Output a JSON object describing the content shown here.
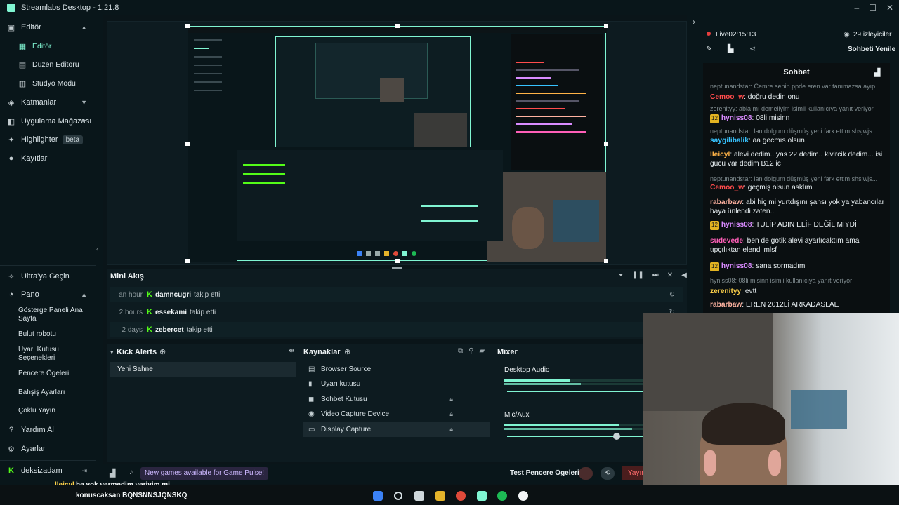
{
  "window": {
    "title": "Streamlabs Desktop - 1.21.8"
  },
  "sidebar": {
    "items": [
      {
        "label": "Editör",
        "icon": "editor-icon",
        "chevron": "⌃"
      },
      {
        "label": "Editör",
        "icon": "editor-sub-icon"
      },
      {
        "label": "Düzen Editörü",
        "icon": "layout-icon"
      },
      {
        "label": "Stüdyo Modu",
        "icon": "studio-icon"
      },
      {
        "label": "Katmanlar",
        "icon": "layers-icon",
        "chevron": "⌄"
      },
      {
        "label": "Uygulama Mağazası",
        "icon": "store-icon",
        "chevron": "⌄"
      },
      {
        "label": "Highlighter",
        "icon": "highlighter-icon",
        "badge": "beta"
      },
      {
        "label": "Kayıtlar",
        "icon": "recordings-icon"
      }
    ],
    "bottom": [
      {
        "label": "Ultra'ya Geçin",
        "icon": "ultra-icon"
      },
      {
        "label": "Pano",
        "icon": "dashboard-icon",
        "chevron": "⌃"
      },
      {
        "label": "Gösterge Paneli Ana Sayfa"
      },
      {
        "label": "Bulut robotu"
      },
      {
        "label": "Uyarı Kutusu Seçenekleri"
      },
      {
        "label": "Pencere Ögeleri"
      },
      {
        "label": "Bahşiş Ayarları"
      },
      {
        "label": "Çoklu Yayın"
      },
      {
        "label": "Yardım Al",
        "icon": "help-icon"
      },
      {
        "label": "Ayarlar",
        "icon": "settings-icon"
      },
      {
        "label": "deksizadam",
        "icon": "kick-icon"
      }
    ]
  },
  "chat_header": {
    "live": "Live02:15:13",
    "viewers": "29 izleyiciler",
    "refresh": "Sohbeti Yenile",
    "panel_title": "Sohbet"
  },
  "chat": [
    {
      "dim": true,
      "text": "neptunandstar: Cemre senin ppde eren var tanımazsa ayıp..."
    },
    {
      "name": "Cemoo_w",
      "color": "#ff4c4c",
      "text": "doğru dedin onu"
    },
    {
      "dim": true,
      "text": "zerenityy: abla mı demeliyim isimli kullanıcıya yanıt veriyor"
    },
    {
      "badge": "12",
      "name": "hyniss08",
      "color": "#d98bff",
      "text": "08li misinn"
    },
    {
      "dim": true,
      "text": "neptunandstar: lan dolgum düşmüş yeni fark ettim shsjwjs..."
    },
    {
      "name": "saygilibalik",
      "color": "#37c3ff",
      "text": "aa gecmıs olsun"
    },
    {
      "name": "lleicyl",
      "color": "#ffb347",
      "text": "alevi dedim.. yas 22 dedim.. kivircik dedim... isi gucu var dedim B12 ic"
    },
    {
      "dim": true,
      "text": "neptunandstar: lan dolgum düşmüş yeni fark ettim shsjwjs..."
    },
    {
      "name": "Cemoo_w",
      "color": "#ff4c4c",
      "text": "geçmiş olsun asklım"
    },
    {
      "name": "rabarbaw",
      "color": "#ffb3a1",
      "text": "abi hiç mi yurtdışını şansı yok ya yabancılar baya ünlendi zaten.."
    },
    {
      "badge": "12",
      "name": "hyniss08",
      "color": "#d98bff",
      "text": "TULİP ADIN ELİF DEĞİL MİYDİ"
    },
    {
      "name": "sudevede",
      "color": "#ff5fb8",
      "text": "ben de gotik alevi ayarlıcaktım ama tıpçılıktan elendi mlsf"
    },
    {
      "badge": "12",
      "name": "hyniss08",
      "color": "#d98bff",
      "text": "sana sormadım"
    },
    {
      "dim": true,
      "text": "hyniss08: 08li misinn isimli kullanıcıya yanıt veriyor"
    },
    {
      "name": "zerenityy",
      "color": "#ffd24a",
      "text": "evtt"
    },
    {
      "name": "rabarbaw",
      "color": "#ffb3a1",
      "text": "EREN 2012Lİ ARKADASLAE"
    }
  ],
  "mini_akis": {
    "title": "Mini Akış",
    "rows": [
      {
        "time": "an hour",
        "user": "damncugri",
        "action": "takip etti"
      },
      {
        "time": "2 hours",
        "user": "essekami",
        "action": "takip etti"
      },
      {
        "time": "2 days",
        "user": "zebercet",
        "action": "takip etti"
      }
    ]
  },
  "scenes": {
    "title": "Kick Alerts",
    "items": [
      "Yeni Sahne"
    ]
  },
  "sources": {
    "title": "Kaynaklar",
    "items": [
      {
        "label": "Browser Source",
        "icon": "browser-icon",
        "locked": false
      },
      {
        "label": "Uyarı kutusu",
        "icon": "alert-icon",
        "locked": false
      },
      {
        "label": "Sohbet Kutusu",
        "icon": "chat-icon",
        "locked": true
      },
      {
        "label": "Video Capture Device",
        "icon": "camera-icon",
        "locked": true
      },
      {
        "label": "Display Capture",
        "icon": "display-icon",
        "locked": true
      }
    ]
  },
  "mixer": {
    "title": "Mixer",
    "channels": [
      {
        "label": "Desktop Audio",
        "level": 0.55
      },
      {
        "label": "Mic/Aux",
        "level": 0.92
      }
    ]
  },
  "footer": {
    "promo": "New games available for Game Pulse!",
    "test": "Test Pencere Ögeleri",
    "live_btn": "Yayın"
  },
  "overlay_chat": {
    "name": "lleicyl",
    "line1": "he yok vermedim veriyim mi",
    "line2": "konuscaksan BQNSNNSJQNSKQ"
  },
  "colors": {
    "accent": "#80f5d2",
    "background": "#09161a",
    "panel": "#0d1b20",
    "live_red": "#e53e3e"
  }
}
